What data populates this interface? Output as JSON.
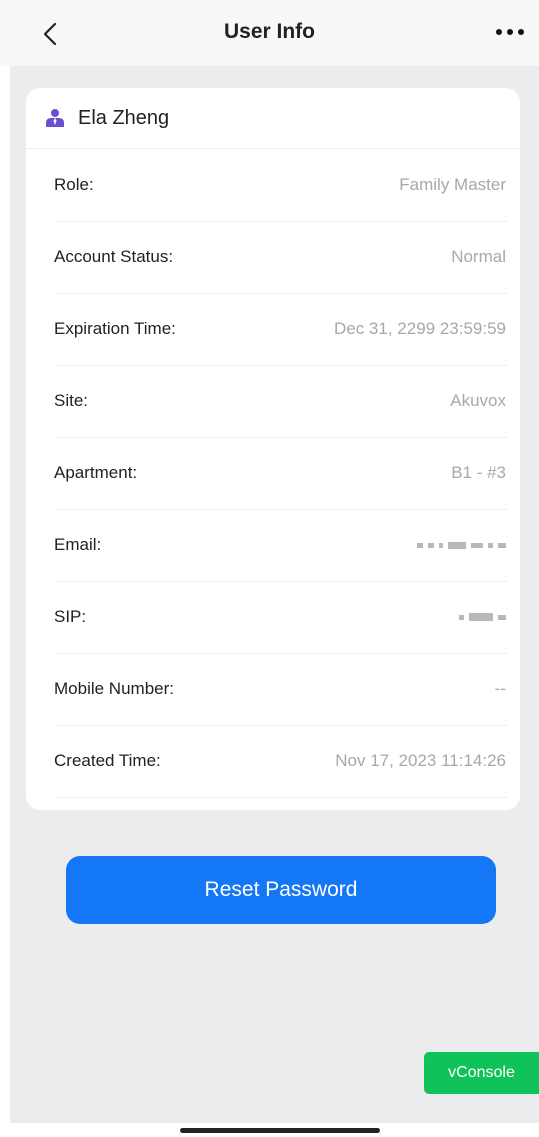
{
  "header": {
    "title": "User Info"
  },
  "user": {
    "name": "Ela Zheng"
  },
  "fields": {
    "role": {
      "label": "Role:",
      "value": "Family Master"
    },
    "account_status": {
      "label": "Account Status:",
      "value": "Normal"
    },
    "expiration_time": {
      "label": "Expiration Time:",
      "value": "Dec 31, 2299 23:59:59"
    },
    "site": {
      "label": "Site:",
      "value": "Akuvox"
    },
    "apartment": {
      "label": "Apartment:",
      "value": "B1 - #3"
    },
    "email": {
      "label": "Email:"
    },
    "sip": {
      "label": "SIP:"
    },
    "mobile_number": {
      "label": "Mobile Number:",
      "value": "--"
    },
    "created_time": {
      "label": "Created Time:",
      "value": "Nov 17, 2023 11:14:26"
    }
  },
  "actions": {
    "reset_password": "Reset Password",
    "vconsole": "vConsole"
  },
  "icons": {
    "back": "chevron-left-icon",
    "more": "more-horizontal-icon",
    "user": "user-icon"
  },
  "colors": {
    "accent": "#1477f5",
    "user_icon": "#6a4fd1",
    "vconsole": "#10c25a"
  }
}
